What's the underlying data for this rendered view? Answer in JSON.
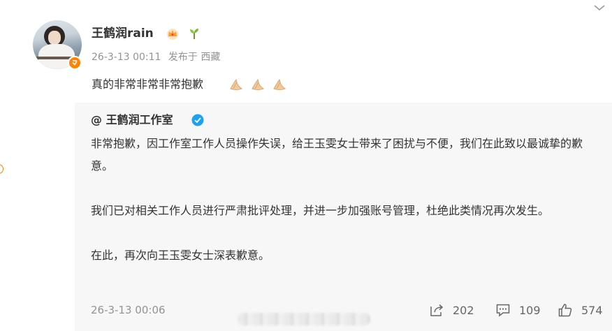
{
  "post": {
    "author_name": "王鹤润rain",
    "badges": [
      "crown-icon",
      "sprout-icon"
    ],
    "time": "26-3-13 00:11",
    "location": "发布于 西藏",
    "text": "真的非常非常非常抱歉",
    "emoji": [
      "pray-icon",
      "pray-icon",
      "pray-icon"
    ]
  },
  "repost": {
    "author": "@ 王鹤润工作室",
    "paragraphs": [
      "非常抱歉，因工作室工作人员操作失误，给王玉雯女士带来了困扰与不便，我们在此致以最诚挚的歉意。",
      "我们已对相关工作人员进行严肃批评处理，并进一步加强账号管理，杜绝此类情况再次发生。",
      "在此，再次向王玉雯女士深表歉意。"
    ],
    "time": "26-3-13 00:06",
    "actions": {
      "share_count": "202",
      "comment_count": "109",
      "like_count": "574"
    }
  },
  "colors": {
    "accent": "#ff8200",
    "verified_blue": "#1da1f2",
    "card_bg": "#f7f7f7",
    "meta_gray": "#939393"
  }
}
